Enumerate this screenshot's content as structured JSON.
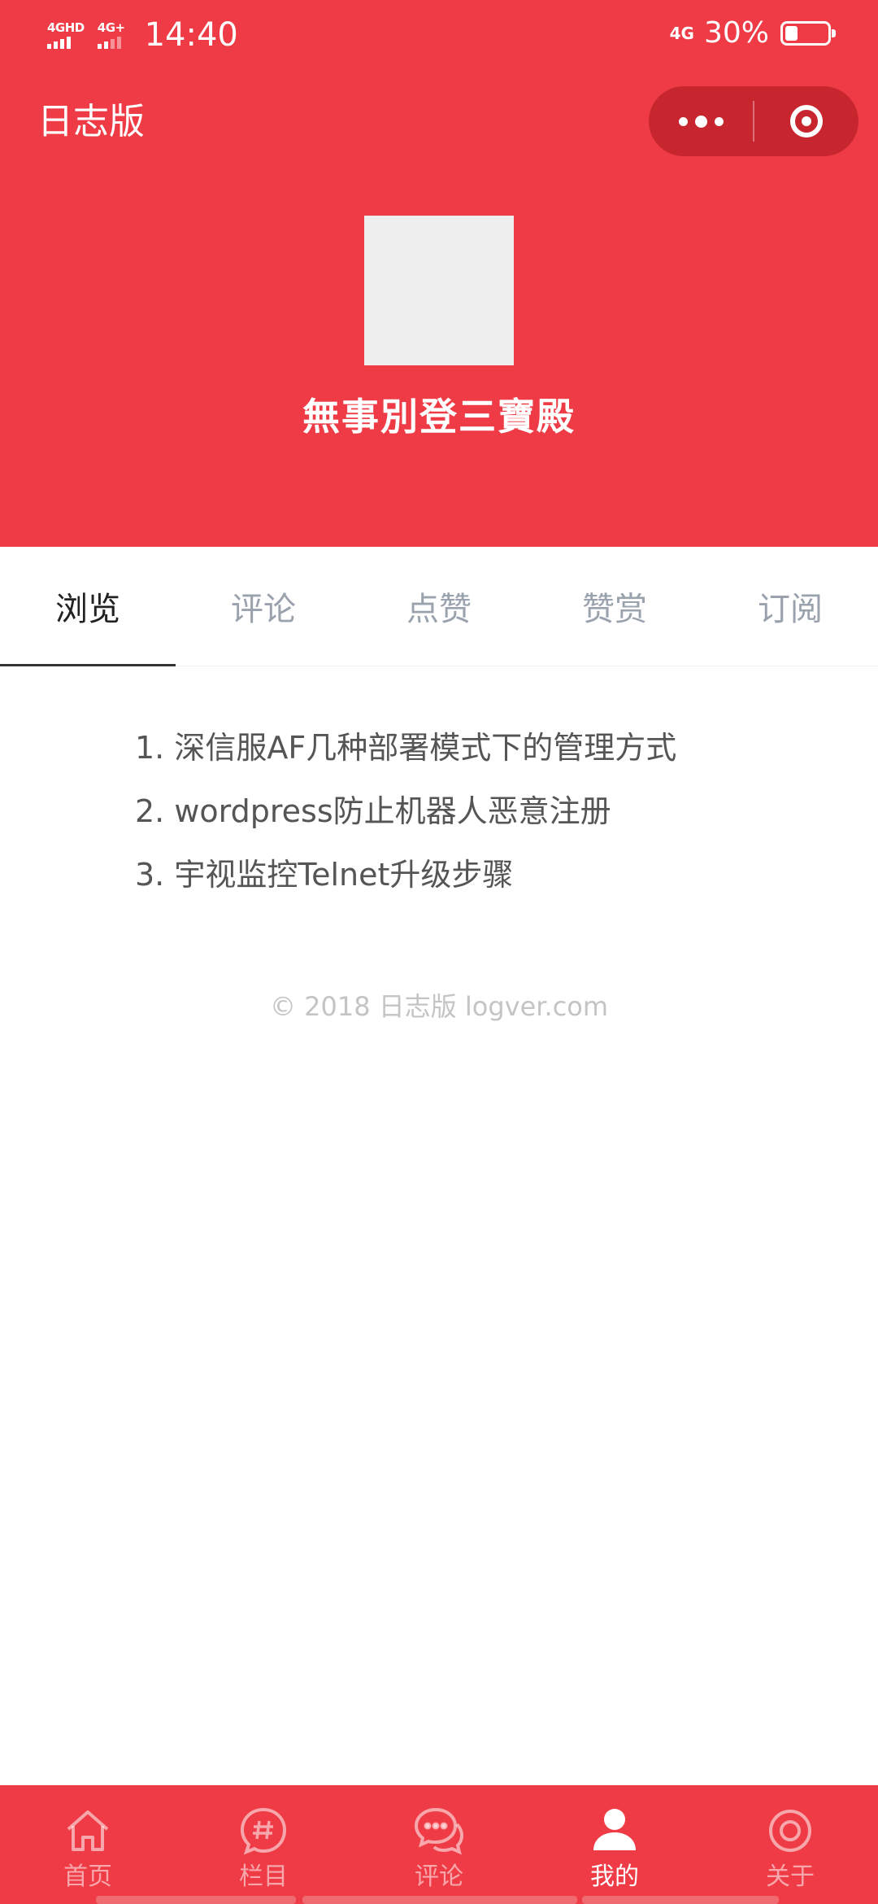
{
  "status_bar": {
    "network_1": "4GHD",
    "network_2": "4G+",
    "time": "14:40",
    "network_right": "4G",
    "battery_percent": "30%",
    "battery_level": 0.3
  },
  "nav": {
    "title": "日志版",
    "more_icon": "more-dots-icon",
    "close_icon": "target-close-icon"
  },
  "profile": {
    "username": "無事別登三寶殿"
  },
  "tabs": [
    {
      "label": "浏览",
      "active": true
    },
    {
      "label": "评论",
      "active": false
    },
    {
      "label": "点赞",
      "active": false
    },
    {
      "label": "赞赏",
      "active": false
    },
    {
      "label": "订阅",
      "active": false
    }
  ],
  "articles": [
    "1. 深信服AF几种部署模式下的管理方式",
    "2. wordpress防止机器人恶意注册",
    "3. 宇视监控Telnet升级步骤"
  ],
  "footer": {
    "copyright": "© 2018 日志版 logver.com"
  },
  "tabbar": [
    {
      "label": "首页",
      "icon": "home-icon",
      "active": false
    },
    {
      "label": "栏目",
      "icon": "hashtag-icon",
      "active": false
    },
    {
      "label": "评论",
      "icon": "chat-bubbles-icon",
      "active": false
    },
    {
      "label": "我的",
      "icon": "user-icon",
      "active": true
    },
    {
      "label": "关于",
      "icon": "target-icon",
      "active": false
    }
  ],
  "colors": {
    "brand_red": "#ee3b45",
    "capsule_red": "#c8262f",
    "tab_inactive": "#9aa3ad"
  }
}
